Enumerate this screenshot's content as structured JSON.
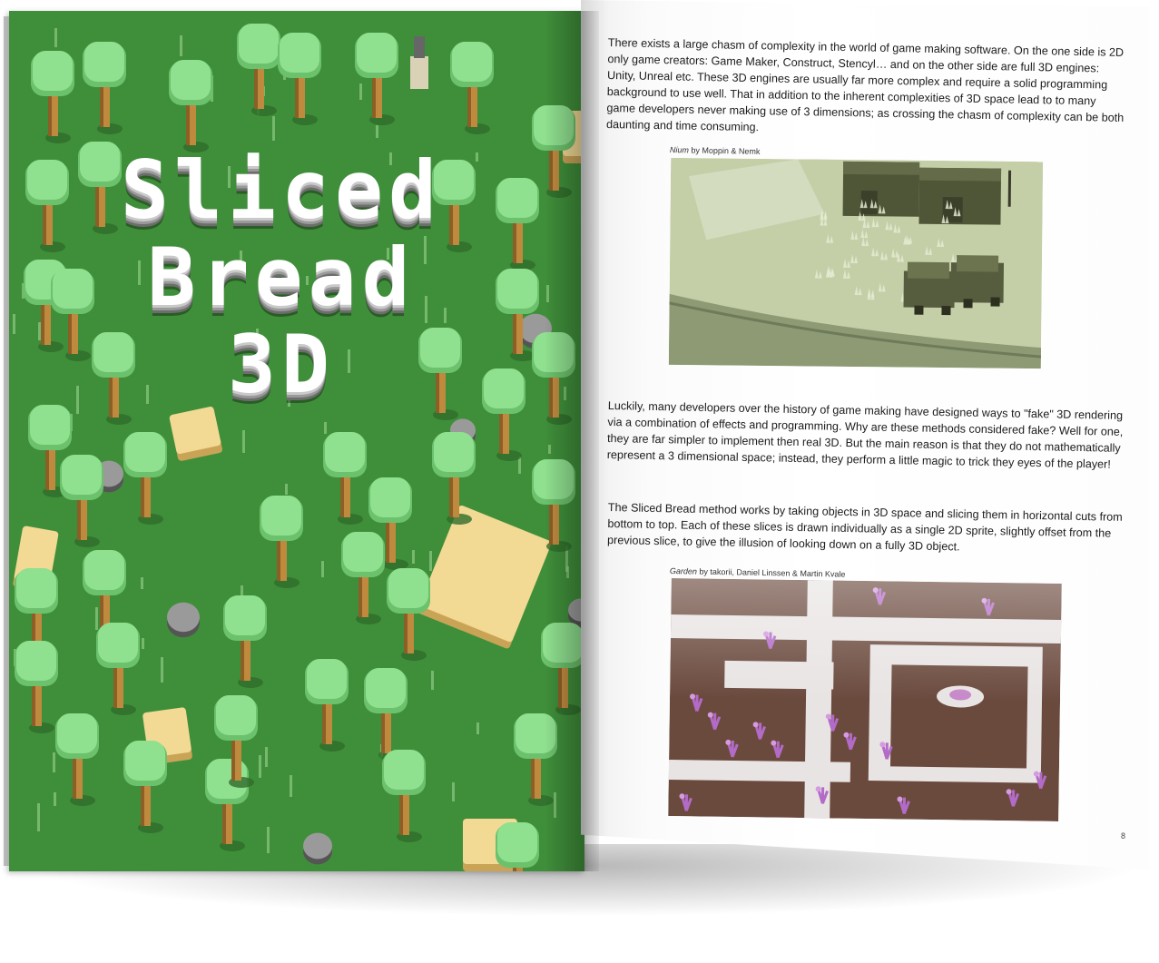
{
  "left_page": {
    "title_lines": [
      "Sliced",
      "Bread",
      "3D"
    ]
  },
  "right_page": {
    "paragraph_1": "There exists a large chasm of complexity in the world of game making software. On the one side is 2D only game creators: Game Maker, Construct, Stencyl… and on the other side are full 3D engines: Unity, Unreal etc. These 3D engines are usually far more complex and require a solid programming background to use well. That in addition to the inherent complexities of 3D space lead to to many game developers never making use of 3 dimensions; as crossing the chasm of complexity can be both daunting and time consuming.",
    "figure_1": {
      "title": "Nium",
      "credit": " by Moppin & Nemk"
    },
    "paragraph_2": "Luckily, many developers over the history of game making have designed ways to \"fake\" 3D rendering via a combination of effects and programming. Why are these methods considered fake? Well for one, they are far simpler to implement then real 3D. But the main reason is that they do not mathematically represent a 3 dimensional space; instead, they perform a little magic to trick they eyes of the player!",
    "paragraph_3": "The Sliced Bread method works by taking objects in 3D space and slicing them in horizontal cuts from bottom to top. Each of these slices is drawn individually as a single 2D sprite, slightly offset from the previous slice, to give the illusion of looking down on a fully 3D object.",
    "figure_2": {
      "title": "Garden",
      "credit": " by takorii, Daniel Linssen & Martin Kvale"
    },
    "page_number": "8"
  },
  "colors": {
    "grass": "#3f8f3a",
    "tree_leaf": "#8fe08f",
    "tree_trunk": "#c08a3e",
    "bread": "#f2d994",
    "rock": "#9a9a9a",
    "nium_bg": "#c4cfa8",
    "garden_bg": "#6b4a3e"
  }
}
